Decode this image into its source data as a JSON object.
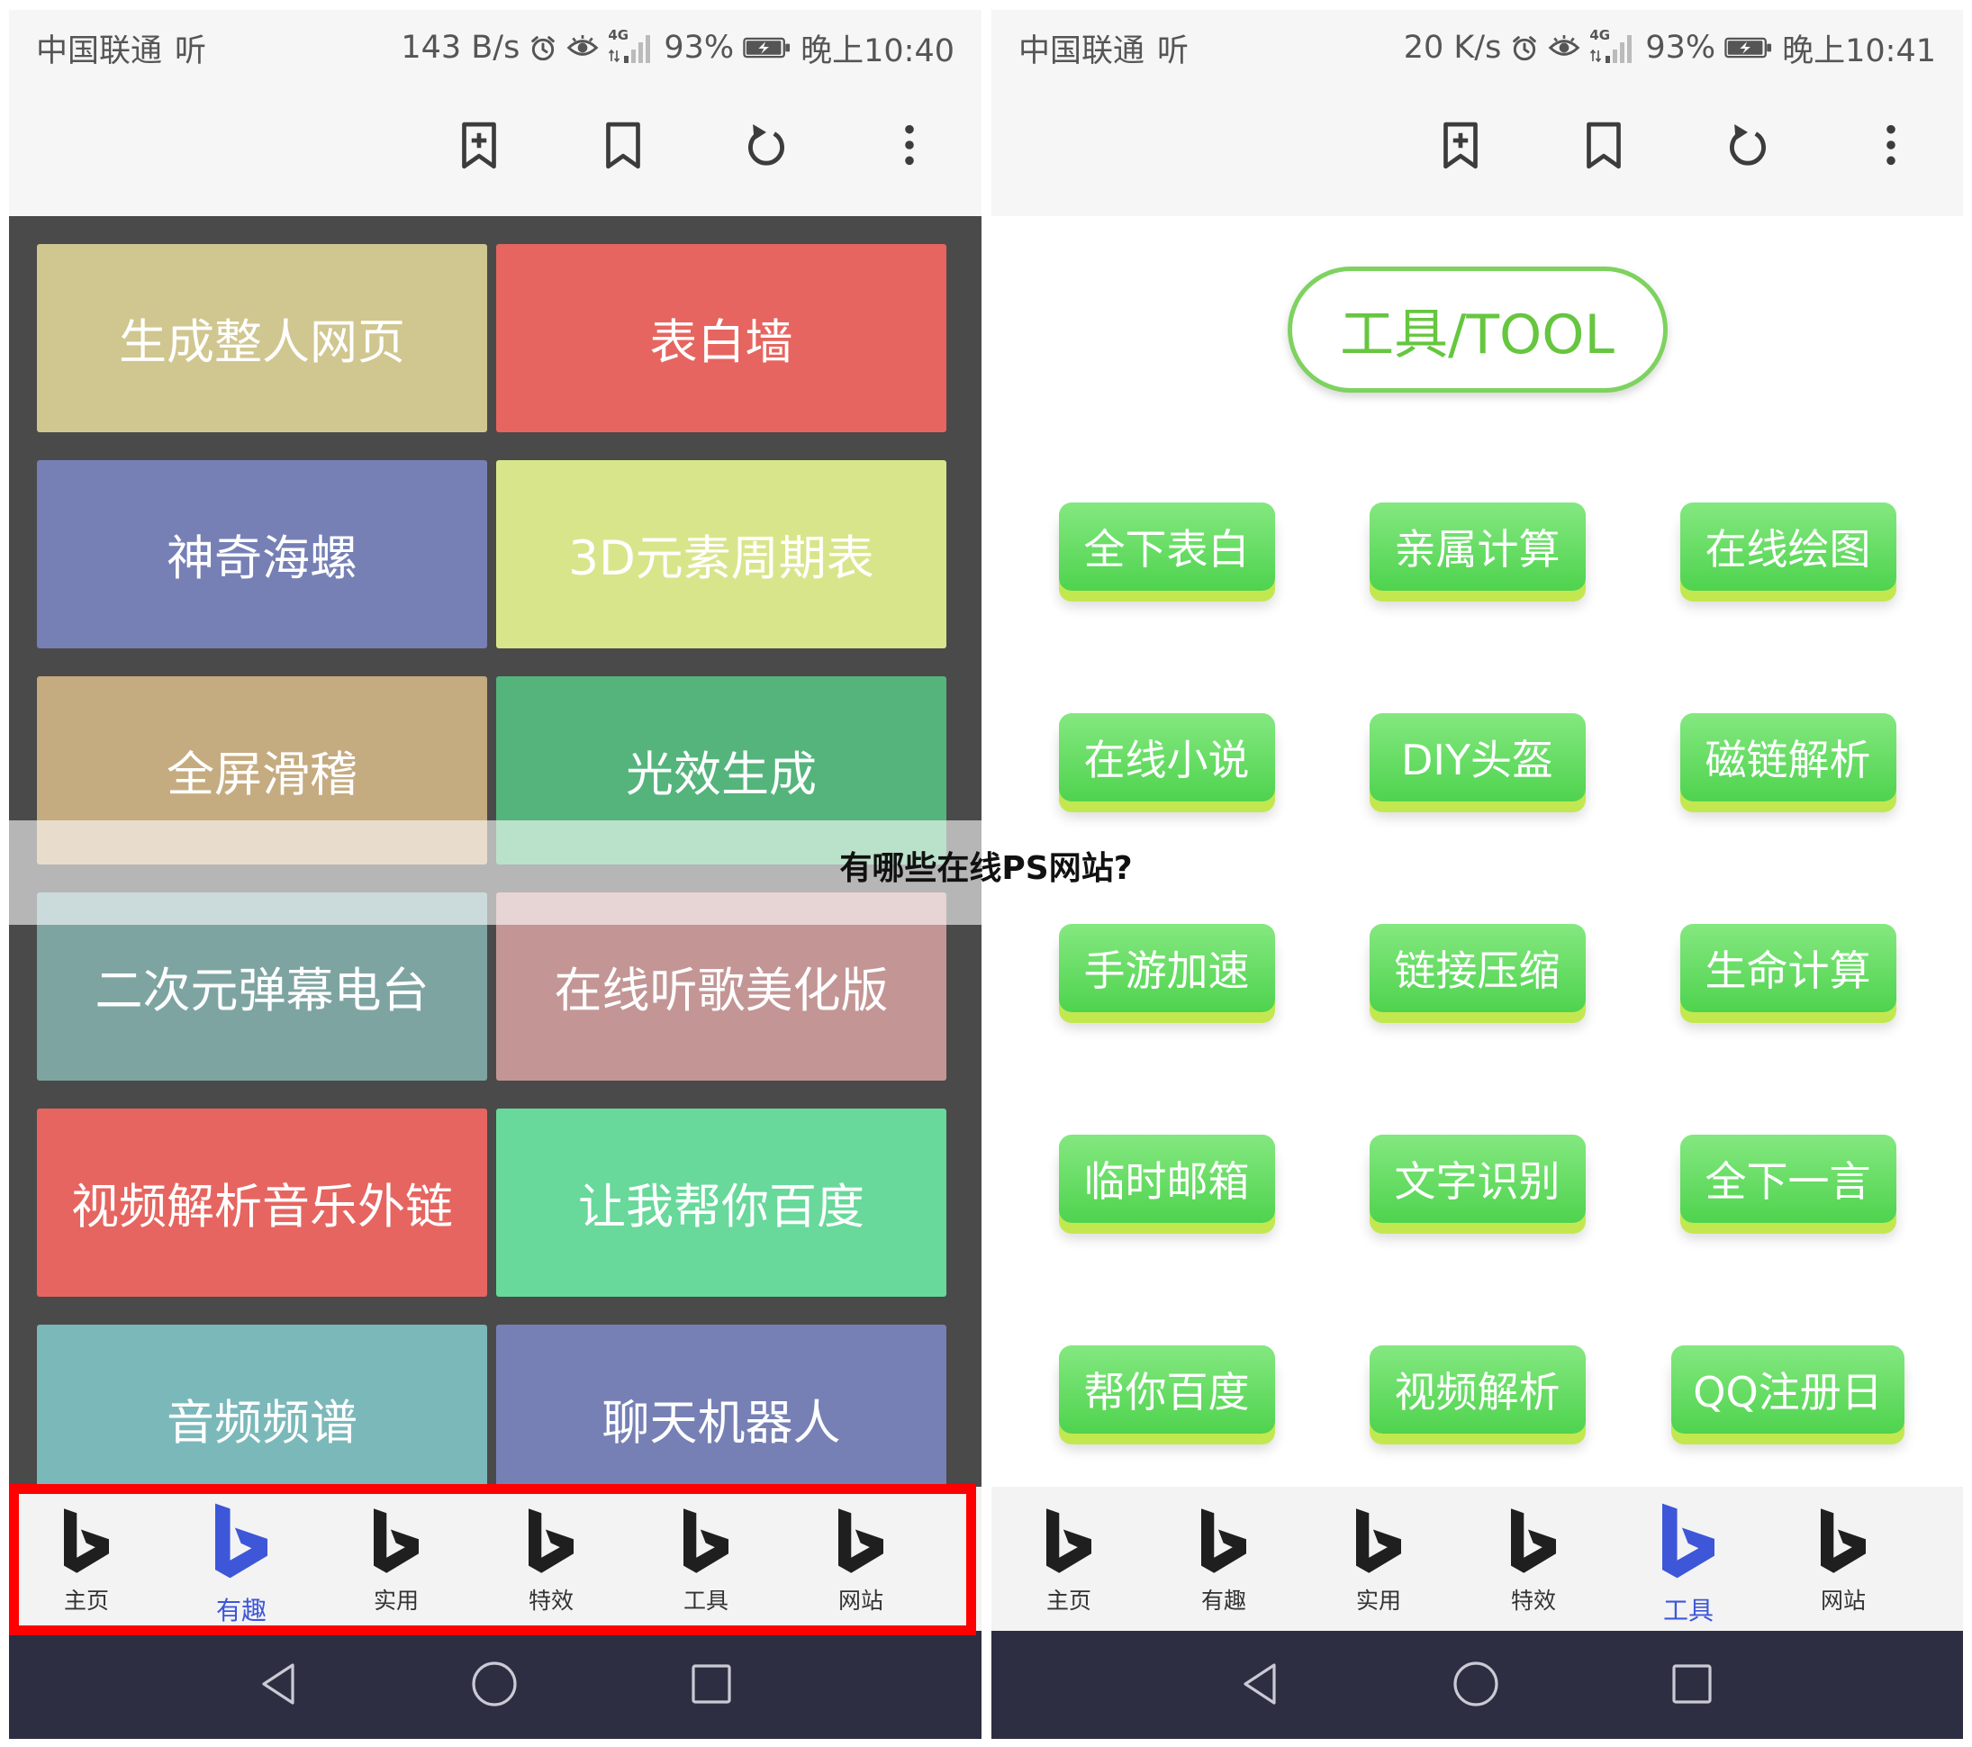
{
  "theme": {
    "nav_active_color": "#3d57d8",
    "highlight_color": "#ff0000",
    "left_panel_bg": "#4a4a4a",
    "system_nav_bg": "#2d2e42",
    "tool_button_green": "#5ad65a",
    "tool_header_color": "#66c63f"
  },
  "watermark": {
    "text": "有哪些在线PS网站?"
  },
  "left": {
    "status_bar": {
      "carrier": "中国联通",
      "hd_badge": "听",
      "network_speed": "143 B/s",
      "network_type": "4G",
      "battery": "93%",
      "time": "晚上10:40"
    },
    "toolbar": {
      "icons": [
        "bookmark-add-icon",
        "bookmark-icon",
        "refresh-icon",
        "more-vert-icon"
      ]
    },
    "tiles": [
      {
        "label": "生成整人网页",
        "color": "#d0c68f"
      },
      {
        "label": "表白墙",
        "color": "#e66560"
      },
      {
        "label": "神奇海螺",
        "color": "#7680b5"
      },
      {
        "label": "3D元素周期表",
        "color": "#d9e58a"
      },
      {
        "label": "全屏滑稽",
        "color": "#c5ab80"
      },
      {
        "label": "光效生成",
        "color": "#54b47c"
      },
      {
        "label": "二次元弹幕电台",
        "color": "#7ea4a2"
      },
      {
        "label": "在线听歌美化版",
        "color": "#c39595"
      },
      {
        "label": "视频解析音乐外链",
        "color": "#e66560"
      },
      {
        "label": "让我帮你百度",
        "color": "#68d89b"
      },
      {
        "label": "音频频谱",
        "color": "#7bb8b9"
      },
      {
        "label": "聊天机器人",
        "color": "#7680b5"
      }
    ],
    "bottom_nav": {
      "items": [
        {
          "label": "主页",
          "icon": "bing-icon",
          "active": false
        },
        {
          "label": "有趣",
          "icon": "bing-icon",
          "active": true
        },
        {
          "label": "实用",
          "icon": "bing-icon",
          "active": false
        },
        {
          "label": "特效",
          "icon": "bing-icon",
          "active": false
        },
        {
          "label": "工具",
          "icon": "bing-icon",
          "active": false
        },
        {
          "label": "网站",
          "icon": "bing-icon",
          "active": false
        }
      ]
    },
    "system_nav": {
      "icons": [
        "back-icon",
        "home-icon",
        "recents-icon"
      ]
    }
  },
  "right": {
    "status_bar": {
      "carrier": "中国联通",
      "hd_badge": "听",
      "network_speed": "20 K/s",
      "network_type": "4G",
      "battery": "93%",
      "time": "晚上10:41"
    },
    "toolbar": {
      "icons": [
        "bookmark-add-icon",
        "bookmark-icon",
        "refresh-icon",
        "more-vert-icon"
      ]
    },
    "header_button": "工具/TOOL",
    "tools": [
      "全下表白",
      "亲属计算",
      "在线绘图",
      "在线小说",
      "DIY头盔",
      "磁链解析",
      "手游加速",
      "链接压缩",
      "生命计算",
      "临时邮箱",
      "文字识别",
      "全下一言",
      "帮你百度",
      "视频解析",
      "QQ注册日"
    ],
    "bottom_nav": {
      "items": [
        {
          "label": "主页",
          "icon": "bing-icon",
          "active": false
        },
        {
          "label": "有趣",
          "icon": "bing-icon",
          "active": false
        },
        {
          "label": "实用",
          "icon": "bing-icon",
          "active": false
        },
        {
          "label": "特效",
          "icon": "bing-icon",
          "active": false
        },
        {
          "label": "工具",
          "icon": "bing-icon",
          "active": true
        },
        {
          "label": "网站",
          "icon": "bing-icon",
          "active": false
        }
      ]
    },
    "system_nav": {
      "icons": [
        "back-icon",
        "home-icon",
        "recents-icon"
      ]
    }
  }
}
